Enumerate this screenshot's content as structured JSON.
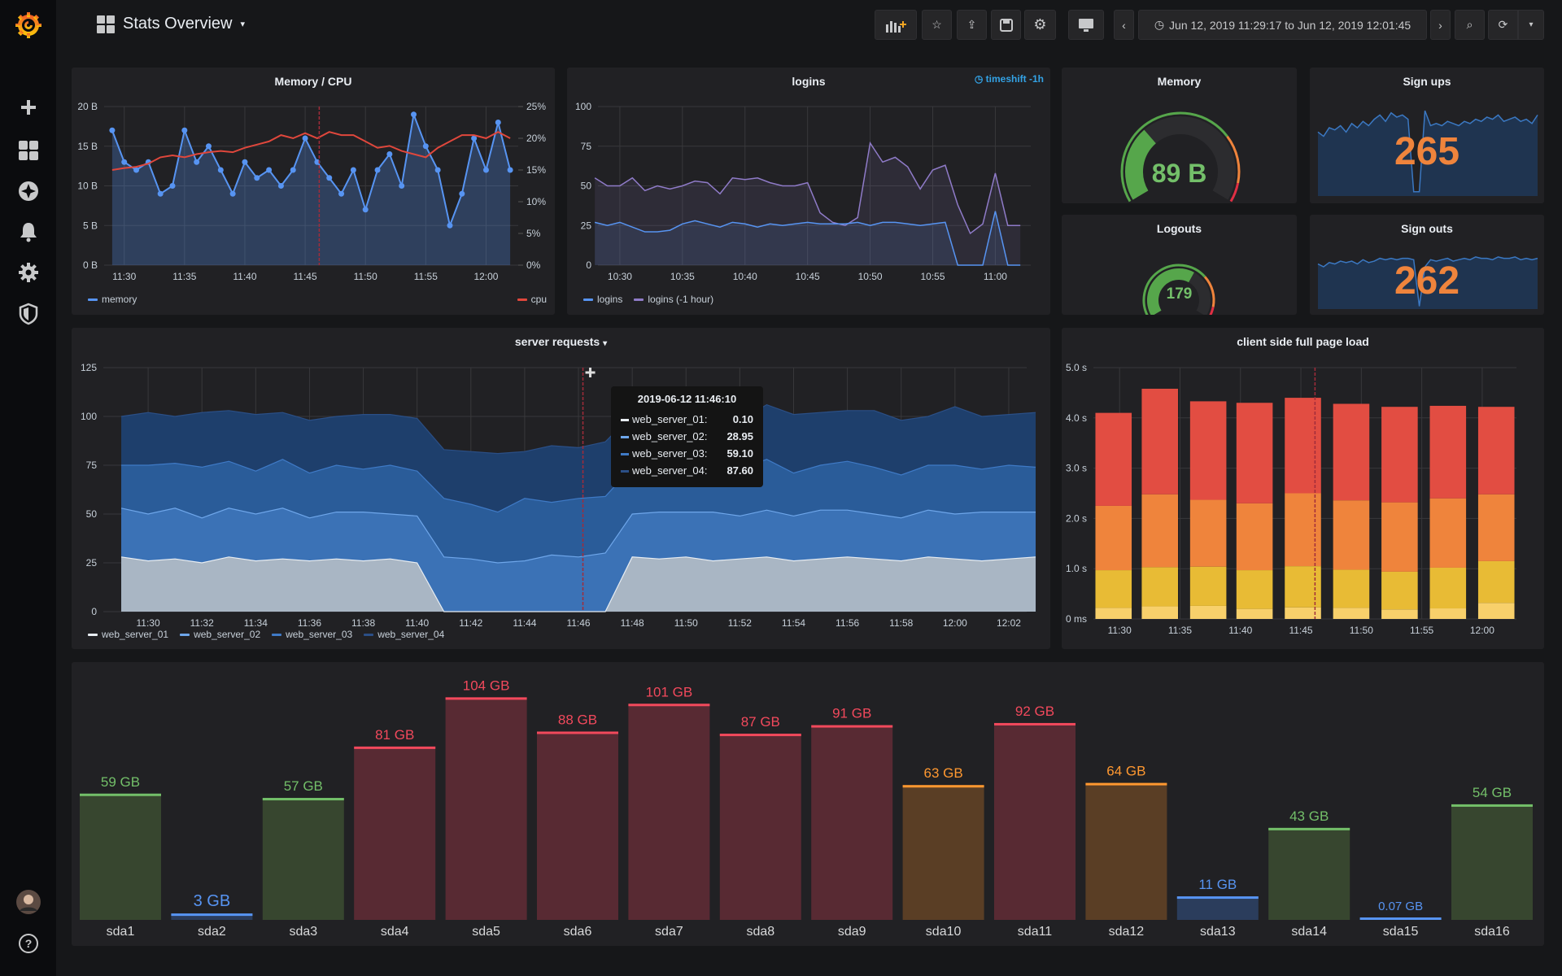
{
  "app": {
    "logo": "grafana-logo-icon"
  },
  "sidebar": {
    "items": [
      {
        "name": "create",
        "icon": "plus-icon"
      },
      {
        "name": "dashboards",
        "icon": "grid-icon"
      },
      {
        "name": "explore",
        "icon": "compass-icon"
      },
      {
        "name": "alerting",
        "icon": "bell-icon"
      },
      {
        "name": "configuration",
        "icon": "gear-icon"
      },
      {
        "name": "server-admin",
        "icon": "shield-icon"
      }
    ],
    "bottom": [
      {
        "name": "profile",
        "icon": "avatar-icon"
      },
      {
        "name": "help",
        "icon": "question-icon"
      }
    ]
  },
  "header": {
    "title": "Stats Overview",
    "time_range": "Jun 12, 2019 11:29:17 to Jun 12, 2019 12:01:45",
    "buttons": [
      "add-panel",
      "star",
      "share",
      "save",
      "settings",
      "tv-mode",
      "time-back",
      "time-forward",
      "zoom-out",
      "refresh",
      "refresh-interval"
    ]
  },
  "panels": {
    "memcpu": {
      "title": "Memory / CPU",
      "legend": [
        {
          "name": "memory",
          "color": "#5794f2"
        },
        {
          "name": "cpu",
          "color": "#e0473c"
        }
      ]
    },
    "logins": {
      "title": "logins",
      "timeshift": "timeshift -1h",
      "legend": [
        {
          "name": "logins",
          "color": "#5794f2"
        },
        {
          "name": "logins (-1 hour)",
          "color": "#8f7bc8"
        }
      ]
    },
    "memory": {
      "title": "Memory",
      "value": "89 B",
      "fill_fraction": 0.33,
      "thresholds": [
        {
          "upto": 0.72,
          "color": "#56a64b"
        },
        {
          "upto": 0.92,
          "color": "#ef843c"
        },
        {
          "upto": 1,
          "color": "#e02f44"
        }
      ]
    },
    "signups": {
      "title": "Sign ups",
      "value": "265",
      "values": [
        30,
        28,
        32,
        31,
        33,
        30,
        34,
        32,
        35,
        33,
        36,
        38,
        35,
        39,
        37,
        38,
        36,
        2,
        2,
        40,
        33,
        34,
        33,
        35,
        34,
        33,
        35,
        34,
        36,
        35,
        37,
        36,
        38,
        35,
        36,
        37,
        35,
        36,
        34,
        38
      ],
      "ylim": [
        0,
        45
      ]
    },
    "logouts": {
      "title": "Logouts",
      "value": "179",
      "fill_fraction": 0.62,
      "thresholds": [
        {
          "upto": 0.7,
          "color": "#56a64b"
        },
        {
          "upto": 0.92,
          "color": "#ef843c"
        },
        {
          "upto": 1,
          "color": "#e02f44"
        }
      ]
    },
    "signouts": {
      "title": "Sign outs",
      "value": "262",
      "values": [
        32,
        30,
        33,
        32,
        34,
        33,
        34,
        32,
        35,
        33,
        34,
        36,
        35,
        36,
        35,
        36,
        36,
        35,
        2,
        30,
        35,
        34,
        35,
        36,
        34,
        35,
        36,
        35,
        37,
        36,
        36,
        35,
        37,
        36,
        36,
        37,
        35,
        36,
        35,
        36
      ],
      "ylim": [
        0,
        45
      ]
    },
    "server": {
      "title": "server requests",
      "tooltip": {
        "time": "2019-06-12 11:46:10",
        "rows": [
          {
            "name": "web_server_01:",
            "value": "0.10",
            "color": "#e8edf2"
          },
          {
            "name": "web_server_02:",
            "value": "28.95",
            "color": "#6ea6ea"
          },
          {
            "name": "web_server_03:",
            "value": "59.10",
            "color": "#3f7ac6"
          },
          {
            "name": "web_server_04:",
            "value": "87.60",
            "color": "#2b4f86"
          }
        ]
      },
      "legend": [
        {
          "name": "web_server_01",
          "color": "#e8edf2"
        },
        {
          "name": "web_server_02",
          "color": "#6ea6ea"
        },
        {
          "name": "web_server_03",
          "color": "#3f7ac6"
        },
        {
          "name": "web_server_04",
          "color": "#2b4f86"
        }
      ]
    },
    "pageload": {
      "title": "client side full page load"
    },
    "disks": {
      "title": ""
    }
  },
  "chart_data": [
    {
      "id": "memcpu",
      "type": "line",
      "xlim": [
        "11:28:20",
        "12:02:40"
      ],
      "xticks": [
        "11:30",
        "11:35",
        "11:40",
        "11:45",
        "11:50",
        "11:55",
        "12:00"
      ],
      "ylim": [
        0,
        20
      ],
      "ytick_labels": [
        "0 B",
        "5 B",
        "10 B",
        "15 B",
        "20 B"
      ],
      "y2lim": [
        0,
        25
      ],
      "y2tick_labels": [
        "0%",
        "5%",
        "10%",
        "15%",
        "20%",
        "25%"
      ],
      "grid": true,
      "legend": "bottom",
      "annotation_time": "11:46:10",
      "series": [
        {
          "name": "memory",
          "axis": "left",
          "start": "11:29",
          "step_min": 1,
          "color": "#5794f2",
          "points": true,
          "values": [
            17,
            13,
            12,
            13,
            9,
            10,
            17,
            13,
            15,
            12,
            9,
            13,
            11,
            12,
            10,
            12,
            16,
            13,
            11,
            9,
            12,
            7,
            12,
            14,
            10,
            19,
            15,
            12,
            5,
            9,
            16,
            12,
            18,
            12
          ]
        },
        {
          "name": "cpu",
          "axis": "right",
          "start": "11:29",
          "step_min": 1,
          "color": "#e0473c",
          "values": [
            15,
            15.3,
            15.5,
            16,
            17,
            17.3,
            17,
            17.5,
            17.8,
            18,
            17.8,
            18.5,
            19,
            19.5,
            20.5,
            20,
            20.8,
            20,
            21,
            20.5,
            20.5,
            19.5,
            18.5,
            18.8,
            18,
            17.5,
            17,
            18.5,
            19.5,
            20.5,
            20.5,
            20,
            21,
            20
          ]
        }
      ]
    },
    {
      "id": "logins",
      "type": "area",
      "xlim": [
        "10:28:15",
        "11:02:50"
      ],
      "xticks": [
        "10:30",
        "10:35",
        "10:40",
        "10:45",
        "10:50",
        "10:55",
        "11:00"
      ],
      "ylim": [
        0,
        100
      ],
      "ytick_labels": [
        "0",
        "25",
        "50",
        "75",
        "100"
      ],
      "grid": true,
      "legend": "bottom",
      "series": [
        {
          "name": "logins (-1 hour)",
          "start": "10:28",
          "step_min": 1,
          "color": "#8f7bc8",
          "values": [
            55,
            50,
            50,
            55,
            47,
            50,
            48,
            50,
            53,
            52,
            45,
            55,
            54,
            55,
            52,
            50,
            50,
            52,
            33,
            27,
            25,
            30,
            77,
            65,
            68,
            62,
            48,
            60,
            63,
            38,
            20,
            26,
            58,
            25,
            25
          ]
        },
        {
          "name": "logins",
          "start": "10:28",
          "step_min": 1,
          "color": "#5794f2",
          "values": [
            27,
            25,
            27,
            24,
            21,
            21,
            22,
            26,
            28,
            26,
            24,
            27,
            26,
            24,
            26,
            25,
            26,
            27,
            26,
            26,
            26,
            27,
            25,
            27,
            27,
            26,
            25,
            26,
            27,
            0,
            0,
            0,
            34,
            0,
            0
          ]
        }
      ]
    },
    {
      "id": "server",
      "type": "area",
      "stacked": true,
      "xlim": [
        "11:28:20",
        "12:02:40"
      ],
      "xticks": [
        "11:30",
        "11:32",
        "11:34",
        "11:36",
        "11:38",
        "11:40",
        "11:42",
        "11:44",
        "11:46",
        "11:48",
        "11:50",
        "11:52",
        "11:54",
        "11:56",
        "11:58",
        "12:00",
        "12:02"
      ],
      "ylim": [
        0,
        125
      ],
      "ytick_labels": [
        "0",
        "25",
        "50",
        "75",
        "100",
        "125"
      ],
      "grid": true,
      "legend": "bottom",
      "annotation_time": "11:46:10",
      "series": [
        {
          "name": "web_server_01",
          "start": "11:29",
          "step_min": 1,
          "color": "#e8edf2",
          "fill": "#a9b6c4",
          "values": [
            28,
            26,
            27,
            25,
            28,
            26,
            27,
            26,
            27,
            26,
            27,
            25,
            0,
            0,
            0,
            0,
            0,
            0,
            0,
            28,
            27,
            28,
            26,
            27,
            28,
            26,
            27,
            28,
            27,
            26,
            28,
            27,
            26,
            27,
            28
          ]
        },
        {
          "name": "web_server_02",
          "start": "11:29",
          "step_min": 1,
          "color": "#6ea6ea",
          "fill": "#3b72b6",
          "values": [
            25,
            24,
            26,
            23,
            25,
            24,
            26,
            22,
            24,
            25,
            23,
            24,
            28,
            27,
            25,
            26,
            29,
            28,
            30,
            22,
            24,
            23,
            25,
            22,
            24,
            23,
            25,
            24,
            23,
            22,
            24,
            23,
            25,
            24,
            23
          ]
        },
        {
          "name": "web_server_03",
          "start": "11:29",
          "step_min": 1,
          "color": "#3f7ac6",
          "fill": "#2a5c99",
          "values": [
            22,
            25,
            23,
            26,
            24,
            22,
            25,
            23,
            24,
            22,
            25,
            23,
            30,
            28,
            26,
            32,
            27,
            30,
            29,
            24,
            22,
            25,
            23,
            24,
            26,
            22,
            23,
            25,
            24,
            22,
            23,
            25,
            22,
            24,
            23
          ]
        },
        {
          "name": "web_server_04",
          "start": "11:29",
          "step_min": 1,
          "color": "#2b4f86",
          "fill": "#1e3f6c",
          "values": [
            25,
            27,
            24,
            28,
            26,
            29,
            24,
            27,
            25,
            28,
            26,
            27,
            25,
            27,
            30,
            24,
            29,
            26,
            28,
            27,
            30,
            26,
            29,
            25,
            28,
            30,
            27,
            26,
            29,
            28,
            25,
            30,
            27,
            26,
            28
          ]
        }
      ]
    },
    {
      "id": "pageload",
      "type": "bar",
      "stacked": true,
      "xlim": [
        "11:27:50",
        "12:02:50"
      ],
      "xticks": [
        "11:30",
        "11:35",
        "11:40",
        "11:45",
        "11:50",
        "11:55",
        "12:00"
      ],
      "ylim": [
        0,
        5
      ],
      "ytick_labels": [
        "0 ms",
        "1.0 s",
        "2.0 s",
        "3.0 s",
        "4.0 s",
        "5.0 s"
      ],
      "grid": true,
      "annotation_time": "11:46:10",
      "x": [
        "11:29:30",
        "11:33:20",
        "11:37:20",
        "11:41:10",
        "11:45:10",
        "11:49:10",
        "11:53:10",
        "11:57:10",
        "12:01:10"
      ],
      "segment_colors": [
        "#f8d06b",
        "#e8bb35",
        "#ef843c",
        "#e24d42"
      ],
      "bars": [
        [
          0.22,
          0.75,
          1.28,
          1.85
        ],
        [
          0.25,
          0.78,
          1.45,
          2.1
        ],
        [
          0.26,
          0.78,
          1.33,
          1.96
        ],
        [
          0.2,
          0.77,
          1.33,
          2.0
        ],
        [
          0.23,
          0.82,
          1.45,
          1.9
        ],
        [
          0.22,
          0.76,
          1.38,
          1.92
        ],
        [
          0.19,
          0.75,
          1.38,
          1.9
        ],
        [
          0.21,
          0.81,
          1.38,
          1.84
        ],
        [
          0.32,
          0.83,
          1.33,
          1.74
        ]
      ]
    },
    {
      "id": "disks",
      "type": "bar",
      "unit": "GB",
      "categories": [
        "sda1",
        "sda2",
        "sda3",
        "sda4",
        "sda5",
        "sda6",
        "sda7",
        "sda8",
        "sda9",
        "sda10",
        "sda11",
        "sda12",
        "sda13",
        "sda14",
        "sda15",
        "sda16"
      ],
      "values": [
        59,
        3,
        57,
        81,
        104,
        88,
        101,
        87,
        91,
        63,
        92,
        64,
        11,
        43,
        0.07,
        54
      ],
      "colors": [
        "#73bf69",
        "#5794f2",
        "#73bf69",
        "#f2495c",
        "#f2495c",
        "#f2495c",
        "#f2495c",
        "#f2495c",
        "#f2495c",
        "#ff9830",
        "#f2495c",
        "#ff9830",
        "#5794f2",
        "#73bf69",
        "#5794f2",
        "#73bf69"
      ],
      "fills": [
        "#37462f",
        "#2b3d5c",
        "#37462f",
        "#582a33",
        "#582a33",
        "#582a33",
        "#582a33",
        "#582a33",
        "#582a33",
        "#5a3e25",
        "#582a33",
        "#5a3e25",
        "#2b3d5c",
        "#37462f",
        "#2b3d5c",
        "#37462f"
      ]
    }
  ]
}
